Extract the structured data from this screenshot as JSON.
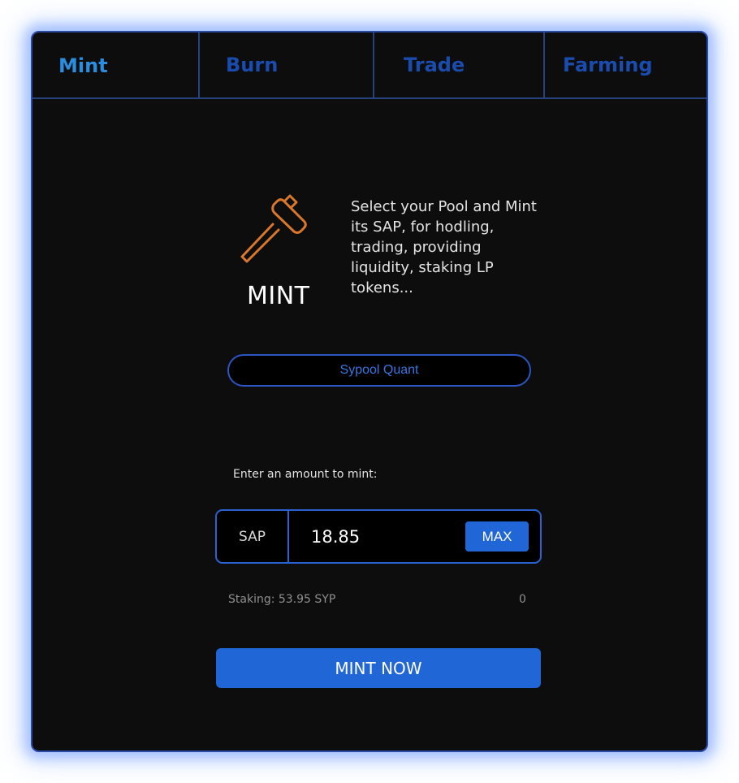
{
  "tabs": [
    {
      "label": "Mint",
      "active": true
    },
    {
      "label": "Burn",
      "active": false
    },
    {
      "label": "Trade",
      "active": false
    },
    {
      "label": "Farming",
      "active": false
    }
  ],
  "hero": {
    "icon": "hammer-icon",
    "title": "MINT",
    "description": "Select your Pool and Mint its SAP, for hodling, trading, providing liquidity, staking LP tokens..."
  },
  "pool_select": {
    "value": "Sypool Quant"
  },
  "amount": {
    "label": "Enter an amount to mint:",
    "unit": "SAP",
    "value": "18.85",
    "max_label": "MAX"
  },
  "staking": {
    "label": "Staking: 53.95 SYP",
    "value": "0"
  },
  "mint_button": {
    "label": "MINT NOW"
  },
  "colors": {
    "accent": "#2166d6",
    "tab_active": "#2a8de0",
    "tab_inactive": "#1a4cb0",
    "icon": "#d9772b",
    "panel_bg": "#0d0d0d"
  }
}
